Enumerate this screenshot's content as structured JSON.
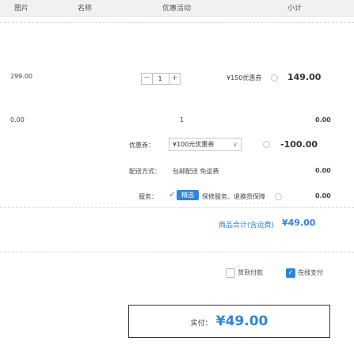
{
  "header": {
    "col1": "图片",
    "col2": "名称",
    "col3": "优惠活动",
    "col4": "小计"
  },
  "item": {
    "price": "299.00",
    "qty_minus": "－",
    "qty_value": "1",
    "qty_plus": "+",
    "promo_label": "¥150优惠券",
    "subtotal": "149.00"
  },
  "row2": {
    "price": "0.00",
    "qty_value": "1",
    "subtotal": "0.00"
  },
  "rows": {
    "coupon_label": "优惠券：",
    "coupon_value": "¥100元优惠券",
    "coupon_amount": "-100.00",
    "shipping_label": "配送方式：",
    "shipping_value": "包邮配送 免运费",
    "shipping_amount": "0.00",
    "service_label": "服务：",
    "service_badge": "精选",
    "service_text": "保修服务、退换货保障",
    "service_amount": "0.00"
  },
  "summary": {
    "total_label": "商品合计(含运费)",
    "total_value": "¥49.00",
    "option1_label": "货到付款",
    "option2_label": "在线支付"
  },
  "pay_button": {
    "label": "实付：",
    "amount": "¥49.00"
  },
  "colors": {
    "accent_blue": "#2f86d8",
    "text": "#333333"
  }
}
